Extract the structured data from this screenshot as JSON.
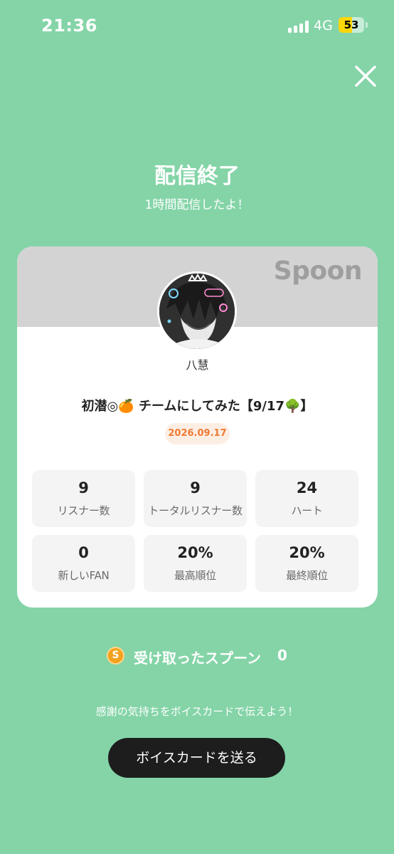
{
  "status_bar": {
    "time": "21:36",
    "network": "4G",
    "battery_level": "53",
    "battery_fraction": 0.53,
    "battery_color": "#ffd60a"
  },
  "close_icon": "close-icon",
  "header": {
    "title": "配信終了",
    "subtitle": "1時間配信したよ！"
  },
  "card": {
    "brand": "Spoon",
    "user_name": "八慧",
    "broadcast_title": "初潜◎🍊 チームにしてみた【9/17🌳】",
    "date": "2026.09.17",
    "stats": [
      {
        "value": "9",
        "label": "リスナー数"
      },
      {
        "value": "9",
        "label": "トータルリスナー数"
      },
      {
        "value": "24",
        "label": "ハート"
      },
      {
        "value": "0",
        "label": "新しいFAN"
      },
      {
        "value": "20%",
        "label": "最高順位"
      },
      {
        "value": "20%",
        "label": "最終順位"
      }
    ]
  },
  "spoons": {
    "coin_glyph": "S",
    "label": "受け取ったスプーン",
    "count": "0"
  },
  "footer": {
    "thanks_text": "感謝の気持ちをボイスカードで伝えよう！",
    "send_button": "ボイスカードを送る"
  },
  "colors": {
    "background": "#84d4a7",
    "card_header": "#d3d3d3",
    "date_badge_text": "#ee7a33",
    "button": "#1d1d1d"
  }
}
